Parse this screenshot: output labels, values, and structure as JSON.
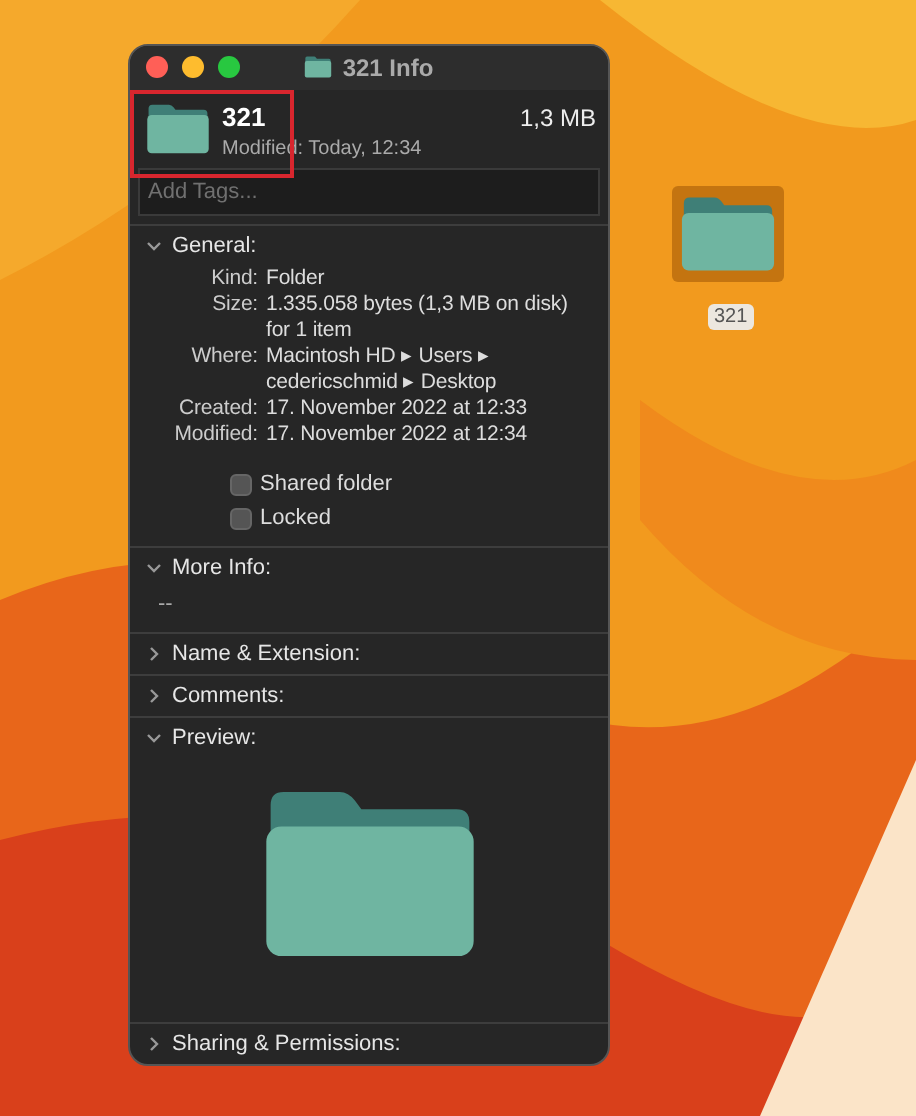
{
  "window": {
    "title": "321 Info"
  },
  "header": {
    "name": "321",
    "size": "1,3 MB",
    "modified": "Modified: Today, 12:34",
    "highlighted": true
  },
  "tags": {
    "placeholder": "Add Tags..."
  },
  "sections": [
    {
      "kind": "general",
      "title": "General:",
      "expanded": true,
      "rows": [
        {
          "label": "Kind:",
          "value": "Folder"
        },
        {
          "label": "Size:",
          "value": "1.335.058 bytes (1,3 MB on disk) for 1 item"
        },
        {
          "label": "Where:",
          "value": "Macintosh HD ▸ Users ▸ cedericschmid ▸ Desktop"
        },
        {
          "label": "Created:",
          "value": "17. November 2022 at 12:33"
        },
        {
          "label": "Modified:",
          "value": "17. November 2022 at 12:34"
        }
      ],
      "checkboxes": [
        {
          "label": "Shared folder",
          "checked": false
        },
        {
          "label": "Locked",
          "checked": false
        }
      ]
    },
    {
      "kind": "text",
      "title": "More Info:",
      "expanded": true,
      "text": "--"
    },
    {
      "kind": "plain",
      "title": "Name & Extension:",
      "expanded": false
    },
    {
      "kind": "plain",
      "title": "Comments:",
      "expanded": false
    },
    {
      "kind": "preview",
      "title": "Preview:",
      "expanded": true
    },
    {
      "kind": "plain",
      "title": "Sharing & Permissions:",
      "expanded": false
    }
  ],
  "desktop": {
    "icon_label": "321",
    "icon_selected": true
  }
}
